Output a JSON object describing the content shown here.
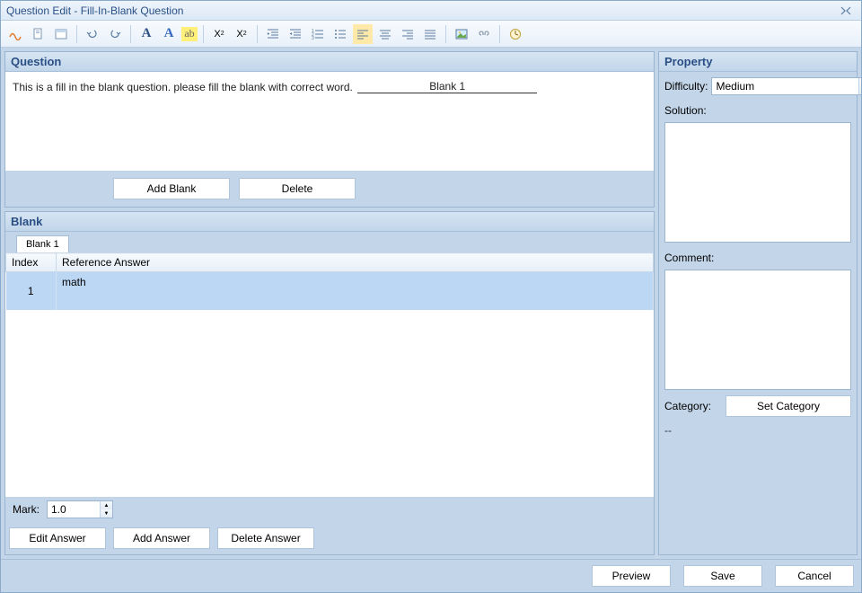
{
  "window": {
    "title": "Question Edit - Fill-In-Blank Question"
  },
  "toolbar": {
    "icons": [
      "squiggle",
      "page",
      "window",
      "undo",
      "redo",
      "font-a",
      "font-a-blue",
      "highlight",
      "subscript",
      "superscript",
      "indent-left",
      "indent-right",
      "list-numbered",
      "list-bullet",
      "align-left",
      "align-center",
      "align-right",
      "align-justify",
      "image",
      "link",
      "clock"
    ]
  },
  "question": {
    "header": "Question",
    "text": "This is a fill in the blank question. please fill the blank with correct word.",
    "blank_label": "Blank 1",
    "add_blank": "Add Blank",
    "delete": "Delete"
  },
  "blank": {
    "header": "Blank",
    "tab": "Blank 1",
    "col_index": "Index",
    "col_ref": "Reference Answer",
    "row_index": "1",
    "row_answer": "math",
    "mark_label": "Mark:",
    "mark_value": "1.0",
    "edit_answer": "Edit Answer",
    "add_answer": "Add Answer",
    "delete_answer": "Delete Answer"
  },
  "property": {
    "header": "Property",
    "difficulty_label": "Difficulty:",
    "difficulty_value": "Medium",
    "solution_label": "Solution:",
    "comment_label": "Comment:",
    "category_label": "Category:",
    "set_category": "Set Category",
    "category_value": "--"
  },
  "footer": {
    "preview": "Preview",
    "save": "Save",
    "cancel": "Cancel"
  }
}
